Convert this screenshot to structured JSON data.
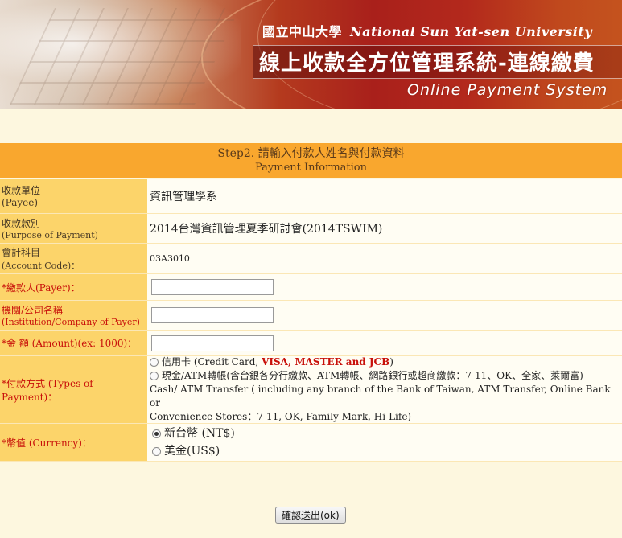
{
  "banner": {
    "university_zh": "國立中山大學",
    "university_en": "National Sun Yat-sen University",
    "system_title": "線上收款全方位管理系統-連線繳費",
    "system_en": "Online Payment System"
  },
  "step": {
    "title_zh": "Step2. 請輸入付款人姓名與付款資料",
    "title_en": "Payment Information"
  },
  "form": {
    "payee": {
      "label_zh": "收款單位",
      "label_en": "(Payee)",
      "value": "資訊管理學系"
    },
    "purpose": {
      "label_zh": "收款款別",
      "label_en": "(Purpose of Payment)",
      "value": "2014台灣資訊管理夏季研討會(2014TSWIM)"
    },
    "account": {
      "label_zh": "會計科目",
      "label_en": "(Account Code)：",
      "value": "03A3010"
    },
    "payer": {
      "label": "*繳款人(Payer)：",
      "value": ""
    },
    "institution": {
      "label_zh": "機關/公司名稱",
      "label_en": "(Institution/Company of Payer)",
      "value": ""
    },
    "amount": {
      "label": "*金 額 (Amount)(ex: 1000)：",
      "value": ""
    },
    "payment_type": {
      "label": "*付款方式 (Types of Payment)：",
      "credit_prefix": "信用卡 (Credit Card, ",
      "credit_cards": "VISA, MASTER and JCB",
      "credit_suffix": ")",
      "cash_zh": "現金/ATM轉帳(含台銀各分行繳款、ATM轉帳、網路銀行或超商繳款：7-11、OK、全家、萊爾富)",
      "cash_en_1": "Cash/ ATM Transfer ( including any branch of the Bank of Taiwan, ATM Transfer, Online Bank or",
      "cash_en_2": "Convenience Stores：7-11, OK, Family Mark, Hi-Life)"
    },
    "currency": {
      "label": "*幣值 (Currency)：",
      "options": [
        "新台幣 (NT$)",
        "美金(US$)"
      ],
      "selected": 0
    }
  },
  "submit_label": "確認送出(ok)"
}
